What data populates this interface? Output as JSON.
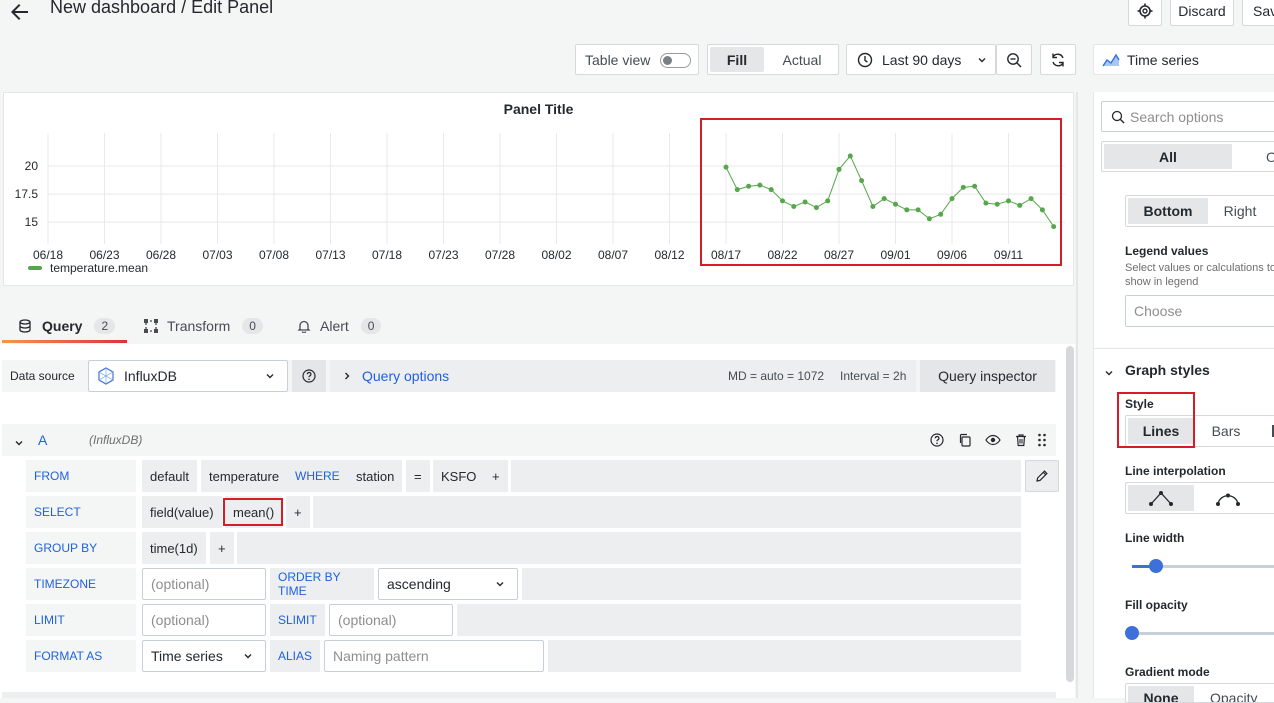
{
  "header": {
    "title": "New dashboard / Edit Panel",
    "discard_label": "Discard",
    "save_label": "Sav"
  },
  "toolbar": {
    "table_view_label": "Table view",
    "fill_label": "Fill",
    "actual_label": "Actual",
    "time_range_label": "Last 90 days",
    "viz_type_label": "Time series"
  },
  "panel": {
    "title": "Panel Title",
    "legend_label": "temperature.mean"
  },
  "chart_data": {
    "type": "line",
    "title": "Panel Title",
    "series": [
      {
        "name": "temperature.mean",
        "color": "#56a64b",
        "x": [
          "08/17",
          "08/18",
          "08/19",
          "08/20",
          "08/21",
          "08/22",
          "08/23",
          "08/24",
          "08/25",
          "08/26",
          "08/27",
          "08/28",
          "08/29",
          "08/30",
          "08/31",
          "09/01",
          "09/02",
          "09/03",
          "09/04",
          "09/05",
          "09/06",
          "09/07",
          "09/08",
          "09/09",
          "09/10",
          "09/11",
          "09/12",
          "09/13",
          "09/14",
          "09/15"
        ],
        "values": [
          19.9,
          17.9,
          18.2,
          18.3,
          17.9,
          16.9,
          16.4,
          16.8,
          16.3,
          16.9,
          19.7,
          20.9,
          18.7,
          16.4,
          17.1,
          16.6,
          16.1,
          16.1,
          15.3,
          15.7,
          17.1,
          18.1,
          18.2,
          16.7,
          16.6,
          16.9,
          16.5,
          17.1,
          16.1,
          14.6
        ]
      }
    ],
    "x_ticks": [
      "06/18",
      "06/23",
      "06/28",
      "07/03",
      "07/08",
      "07/13",
      "07/18",
      "07/23",
      "07/28",
      "08/02",
      "08/07",
      "08/12",
      "08/17",
      "08/22",
      "08/27",
      "09/01",
      "09/06",
      "09/11"
    ],
    "y_ticks": [
      "15",
      "17.5",
      "20"
    ],
    "ylim": [
      13.5,
      22.5
    ],
    "grid": true,
    "legend": "bottom-left"
  },
  "tabs": [
    {
      "label": "Query",
      "count": "2"
    },
    {
      "label": "Transform",
      "count": "0"
    },
    {
      "label": "Alert",
      "count": "0"
    }
  ],
  "query_bar": {
    "data_source_label": "Data source",
    "data_source_value": "InfluxDB",
    "query_options_label": "Query options",
    "md_text": "MD = auto = 1072",
    "interval_text": "Interval = 2h",
    "inspector_label": "Query inspector"
  },
  "query": {
    "ref_id": "A",
    "ds_hint": "(InfluxDB)",
    "from_label": "FROM",
    "from_policy": "default",
    "from_measurement": "temperature",
    "where_label": "WHERE",
    "where_key": "station",
    "where_op": "=",
    "where_value": "KSFO",
    "plus": "+",
    "select_label": "SELECT",
    "select_field": "field(value)",
    "select_func": "mean()",
    "group_label": "GROUP BY",
    "group_time": "time(1d)",
    "timezone_label": "TIMEZONE",
    "optional_placeholder": "(optional)",
    "order_label": "ORDER BY TIME",
    "order_value": "ascending",
    "limit_label": "LIMIT",
    "slimit_label": "SLIMIT",
    "format_label": "FORMAT AS",
    "format_value": "Time series",
    "alias_label": "ALIAS",
    "alias_placeholder": "Naming pattern"
  },
  "options": {
    "search_placeholder": "Search options",
    "all_label": "All",
    "overrides_label": "O",
    "placement_bottom": "Bottom",
    "placement_right": "Right",
    "legend_values_label": "Legend values",
    "legend_values_desc": "Select values or calculations to show in legend",
    "choose_placeholder": "Choose",
    "graph_styles_label": "Graph styles",
    "style_label": "Style",
    "style_lines": "Lines",
    "style_bars": "Bars",
    "line_interp_label": "Line interpolation",
    "line_width_label": "Line width",
    "line_width_value": 0.05,
    "fill_opacity_label": "Fill opacity",
    "fill_opacity_value": 0,
    "gradient_label": "Gradient mode",
    "gradient_none": "None",
    "gradient_opacity": "Opacity"
  }
}
